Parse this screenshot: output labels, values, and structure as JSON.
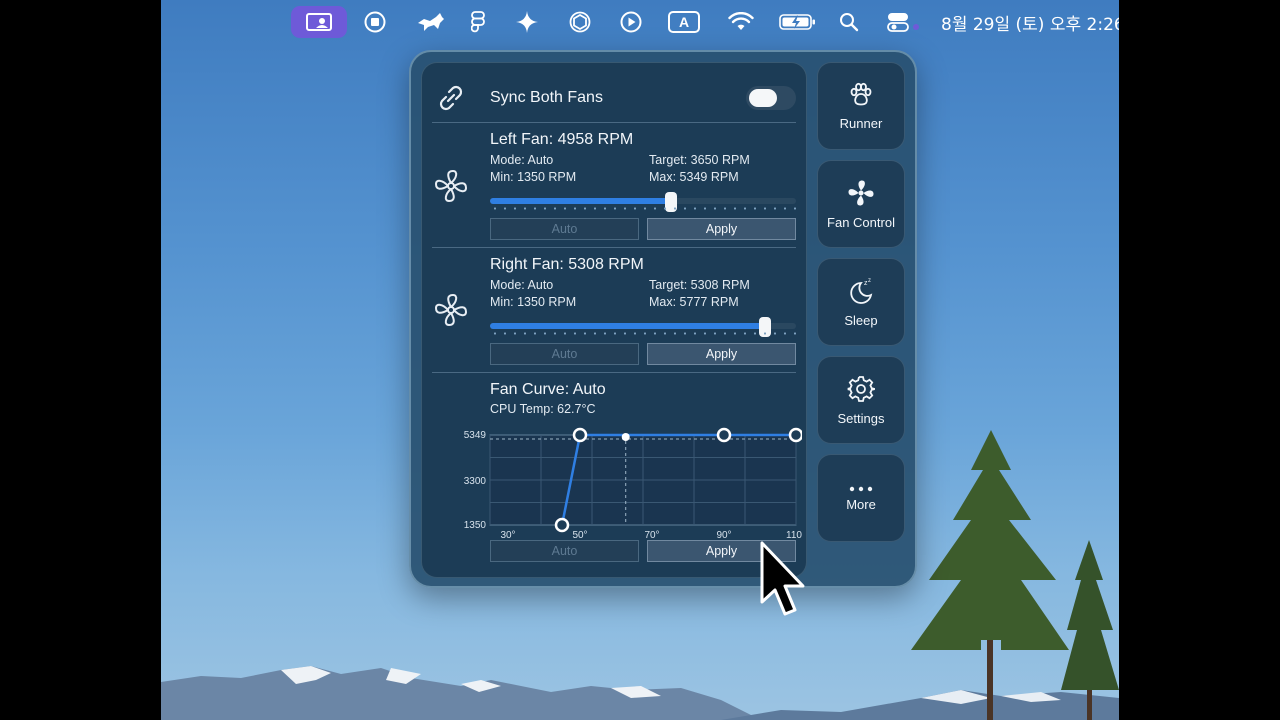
{
  "menubar": {
    "icons": [
      "screen-share-icon",
      "stop-record-icon",
      "dog-icon",
      "figma-icon",
      "sparkle-icon",
      "openai-icon",
      "play-icon",
      "keyboard-input-icon",
      "wifi-icon",
      "battery-charging-icon",
      "search-icon",
      "control-center-icon"
    ],
    "input_source": "A",
    "clock": "8월 29일 (토) 오후 2:26"
  },
  "sync": {
    "label": "Sync Both Fans",
    "enabled": false
  },
  "left_fan": {
    "title": "Left Fan: 4958 RPM",
    "mode": "Mode: Auto",
    "target": "Target: 3650 RPM",
    "min": "Min: 1350 RPM",
    "max": "Max: 5349 RPM",
    "slider_fraction": 0.59,
    "auto_label": "Auto",
    "apply_label": "Apply"
  },
  "right_fan": {
    "title": "Right Fan: 5308 RPM",
    "mode": "Mode: Auto",
    "target": "Target: 5308 RPM",
    "min": "Min: 1350 RPM",
    "max": "Max: 5777 RPM",
    "slider_fraction": 0.9,
    "auto_label": "Auto",
    "apply_label": "Apply"
  },
  "fan_curve": {
    "title": "Fan Curve: Auto",
    "cpu_temp": "CPU Temp: 62.7°C",
    "auto_label": "Auto",
    "apply_label": "Apply"
  },
  "chart_data": {
    "type": "line",
    "x": [
      45,
      50,
      90,
      110
    ],
    "y": [
      1350,
      5349,
      5349,
      5349
    ],
    "current_point": {
      "x": 62.7,
      "y": 5349
    },
    "xlim": [
      25,
      110
    ],
    "ylim": [
      1350,
      5349
    ],
    "x_ticks": [
      "30°",
      "50°",
      "70°",
      "90°",
      "110°"
    ],
    "x_tick_values": [
      30,
      50,
      70,
      90,
      110
    ],
    "y_ticks": [
      "5349",
      "3300",
      "1350"
    ],
    "y_tick_values": [
      5349,
      3300,
      1350
    ],
    "grid": true,
    "color": "#2f7fe3"
  },
  "side": {
    "runner": "Runner",
    "fan_control": "Fan Control",
    "sleep": "Sleep",
    "settings": "Settings",
    "more": "More"
  }
}
